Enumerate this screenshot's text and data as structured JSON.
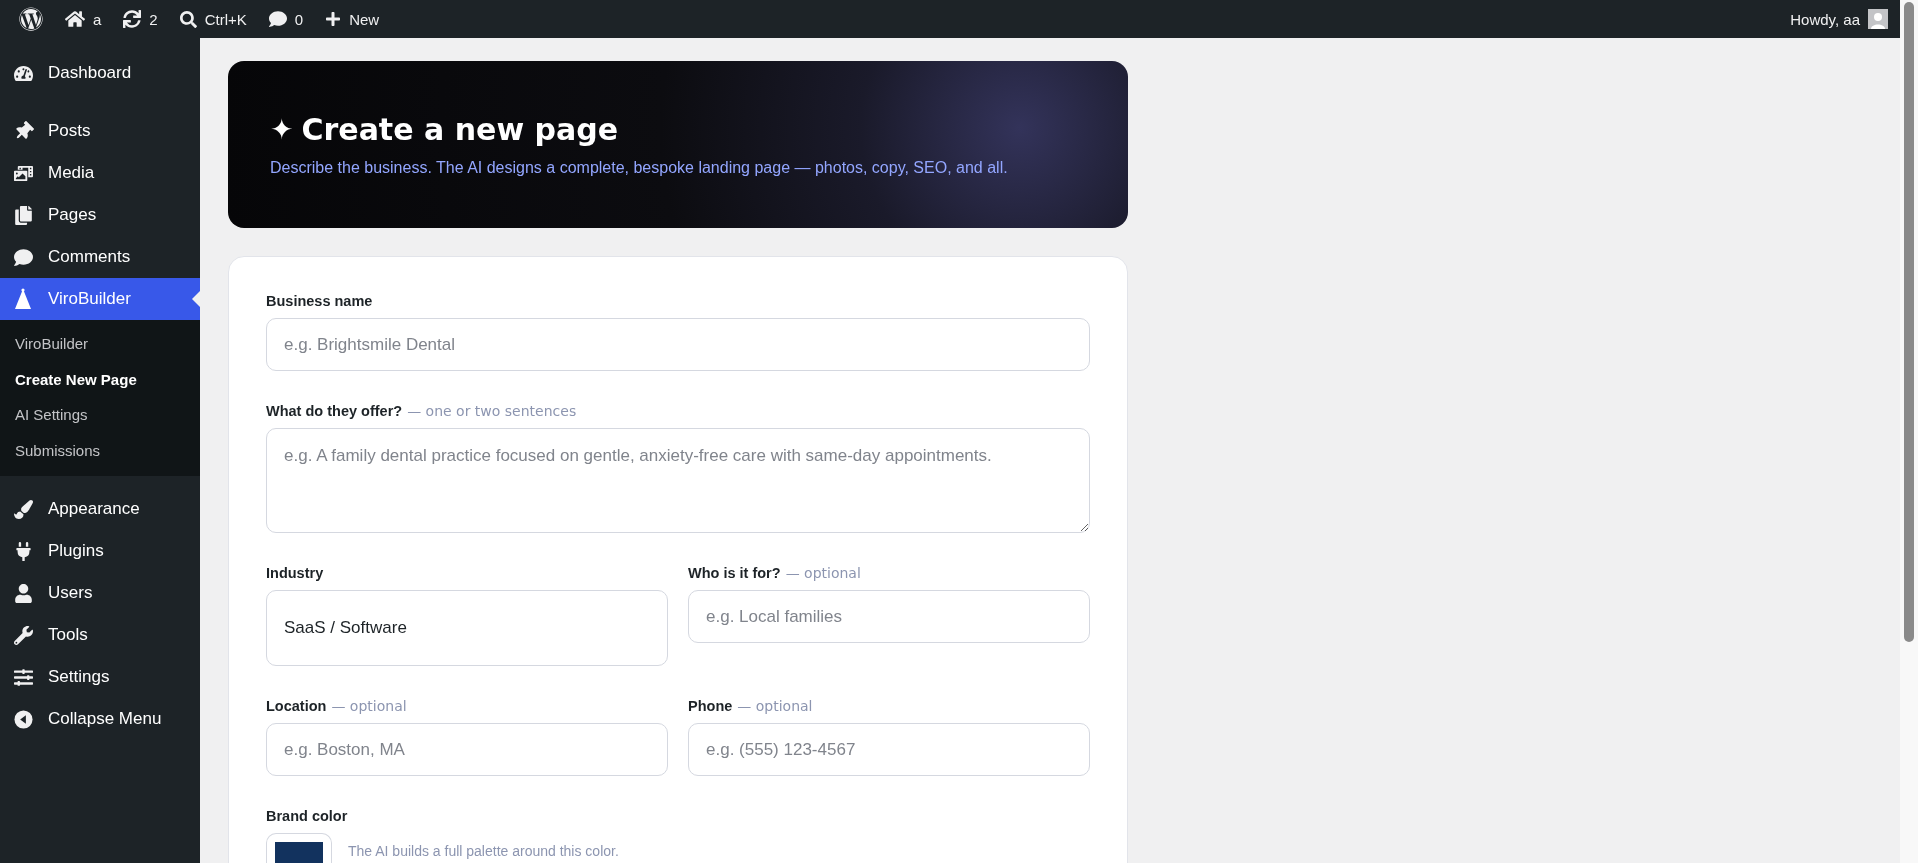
{
  "toolbar": {
    "items": [
      {
        "kind": "logo"
      },
      {
        "kind": "home",
        "label": "a"
      },
      {
        "kind": "updates",
        "label": "2"
      },
      {
        "kind": "search",
        "label": "Ctrl+K"
      },
      {
        "kind": "comments",
        "label": "0"
      },
      {
        "kind": "new",
        "label": "New"
      }
    ],
    "greeting": "Howdy, aa"
  },
  "sidebar": {
    "items": [
      {
        "kind": "dashboard",
        "label": "Dashboard",
        "selected": false
      },
      {
        "kind": "posts",
        "label": "Posts",
        "selected": false
      },
      {
        "kind": "media",
        "label": "Media",
        "selected": false
      },
      {
        "kind": "pages",
        "label": "Pages",
        "selected": false
      },
      {
        "kind": "comments",
        "label": "Comments",
        "selected": false
      },
      {
        "kind": "cone",
        "label": "ViroBuilder",
        "selected": true,
        "children": [
          {
            "label": "ViroBuilder",
            "selected": false
          },
          {
            "label": "Create New Page",
            "selected": true
          },
          {
            "label": "AI Settings",
            "selected": false
          },
          {
            "label": "Submissions",
            "selected": false
          }
        ]
      },
      {
        "kind": "appearance",
        "label": "Appearance",
        "selected": false
      },
      {
        "kind": "plugins",
        "label": "Plugins",
        "selected": false
      },
      {
        "kind": "users",
        "label": "Users",
        "selected": false
      },
      {
        "kind": "tools",
        "label": "Tools",
        "selected": false
      },
      {
        "kind": "settings",
        "label": "Settings",
        "selected": false
      },
      {
        "kind": "collapse",
        "label": "Collapse Menu",
        "selected": false
      }
    ]
  },
  "header": {
    "icon": "✦",
    "title": "Create a new page",
    "subtitle": "Describe the business. The AI designs a complete, bespoke landing page — photos, copy, SEO, and all."
  },
  "form": {
    "rows": [
      {
        "fields": [
          {
            "kind": "input",
            "label": "Business name",
            "placeholder": "e.g. Brightsmile Dental"
          }
        ]
      },
      {
        "fields": [
          {
            "kind": "textarea",
            "label": "What do they offer?",
            "note": "— one or two sentences",
            "placeholder": "e.g. A family dental practice focused on gentle, anxiety-free care with same-day appointments."
          }
        ]
      },
      {
        "fields": [
          {
            "kind": "select",
            "label": "Industry",
            "value": "SaaS / Software"
          },
          {
            "kind": "input",
            "label": "Who is it for?",
            "note": "— optional",
            "placeholder": "e.g. Local families"
          }
        ]
      },
      {
        "fields": [
          {
            "kind": "input",
            "label": "Location",
            "note": "— optional",
            "placeholder": "e.g. Boston, MA"
          },
          {
            "kind": "input",
            "label": "Phone",
            "note": "— optional",
            "placeholder": "e.g. (555) 123-4567"
          }
        ]
      },
      {
        "fields": [
          {
            "kind": "color",
            "label": "Brand color",
            "color": "#12325e",
            "hint": "The AI builds a full palette around this color."
          }
        ]
      }
    ]
  }
}
